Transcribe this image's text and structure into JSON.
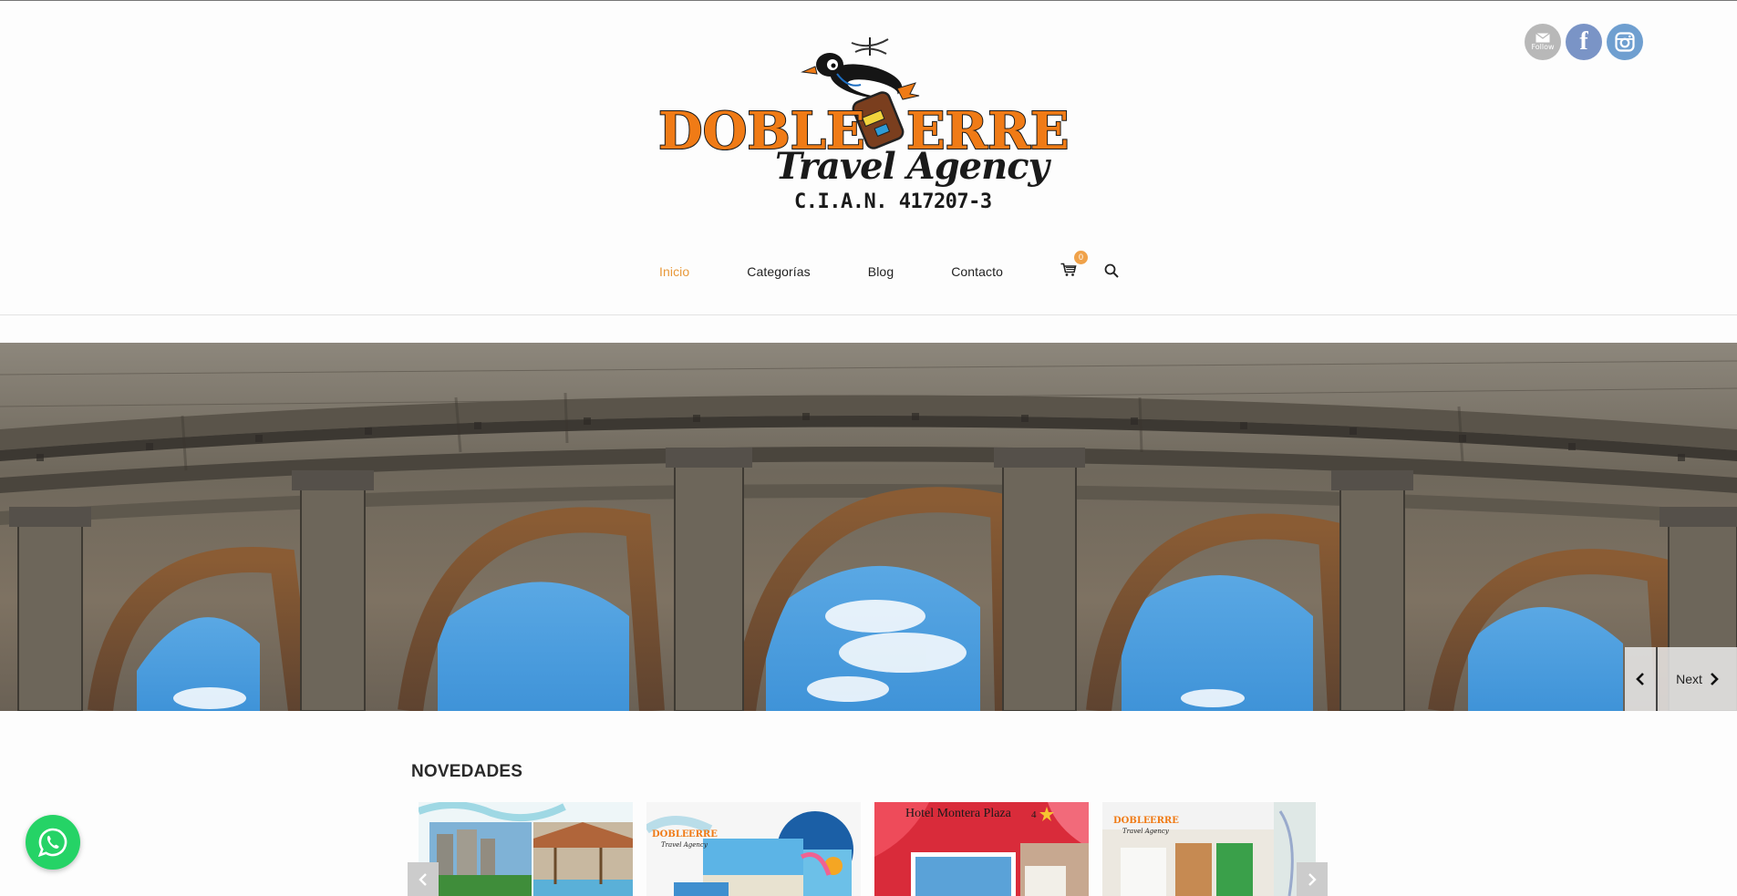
{
  "social": {
    "follow_label": "Follow",
    "facebook_glyph": "f",
    "icons": [
      "mail-icon",
      "facebook-icon",
      "instagram-icon"
    ]
  },
  "logo": {
    "word1": "DOBLE",
    "word2": "ERRE",
    "subtitle": "Travel Agency",
    "cian": "C.I.A.N. 417207-3"
  },
  "nav": {
    "items": [
      {
        "label": "Inicio",
        "active": true
      },
      {
        "label": "Categorías",
        "active": false
      },
      {
        "label": "Blog",
        "active": false
      },
      {
        "label": "Contacto",
        "active": false
      }
    ],
    "cart_count": "0",
    "icons": [
      "cart-icon",
      "search-icon"
    ]
  },
  "hero": {
    "next_label": "Next",
    "icons": [
      "chevron-left-icon",
      "chevron-right-icon"
    ]
  },
  "novedades": {
    "title": "NOVEDADES",
    "cards": [
      {
        "caption": ""
      },
      {
        "logo_word1": "DOBLE",
        "logo_word2": "ERRE",
        "logo_sub": "Travel Agency"
      },
      {
        "caption": "Hotel Montera Plaza",
        "stars": "4"
      },
      {
        "logo_word1": "DOBLE",
        "logo_word2": "ERRE",
        "logo_sub": "Travel Agency"
      }
    ]
  },
  "colors": {
    "accent": "#e8993a",
    "logo_orange": "#f07b16",
    "whatsapp": "#25d366",
    "facebook": "#7a94c6"
  }
}
